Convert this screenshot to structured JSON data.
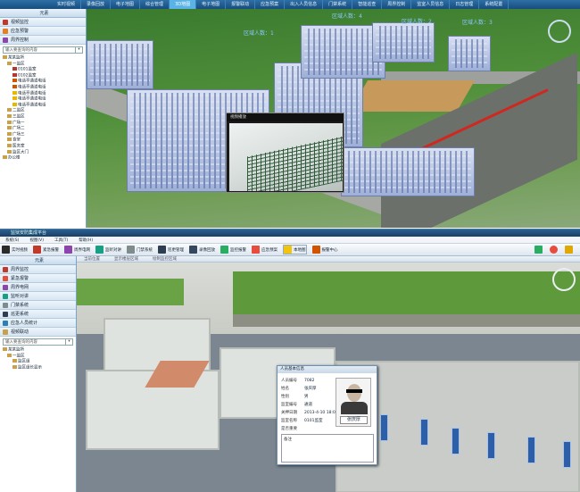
{
  "top": {
    "nav_tabs": [
      "实时视频",
      "录像回放",
      "电子地图",
      "综合管理",
      "3D地图",
      "电子地图",
      "报警联动",
      "应急预案",
      "出入人员信息",
      "门禁系统",
      "智能巡查",
      "周界控制",
      "监室人员信息",
      "日志管理",
      "系统配置"
    ],
    "active_tab": "3D地图",
    "left_header": "元素",
    "side_items": [
      "视频监控",
      "应急预警",
      "周界控制"
    ],
    "search_placeholder": "输入要查询的内容",
    "tree": [
      "某某监所",
      "一监区",
      "0101监室",
      "0102监室",
      "电话亭通道电话",
      "电话亭通道电话",
      "电话亭通道电话",
      "电话亭通道电话",
      "电话亭通道电话",
      "二监区",
      "三监区",
      "广场一",
      "广场二",
      "广场三",
      "食堂",
      "医务室",
      "监区大门",
      "办公楼"
    ],
    "area_labels": [
      "区域人数：4",
      "区域人数：2",
      "区域人数：3",
      "区域人数：1"
    ],
    "video_popup_title": "视频播放"
  },
  "bottom": {
    "title": "监狱安防集成平台",
    "menu": [
      "系统(S)",
      "视图(V)",
      "工具(T)",
      "帮助(H)"
    ],
    "toolbar": [
      "实时视频",
      "紧急报警",
      "周界电网",
      "监听对讲",
      "门禁系统",
      "巡更管理",
      "录像回放",
      "监控报警",
      "应急预案",
      "本地图",
      "报警中心"
    ],
    "toolbar_active": "本地图",
    "subbar": [
      "当前位置",
      "显示楼层区域",
      "绘制监控区域"
    ],
    "left_header": "元素",
    "side_items": [
      "周界监控",
      "紧急报警",
      "周界电网",
      "监听对讲",
      "门禁系统",
      "巡更系统",
      "应急人员统计",
      "视频联动"
    ],
    "search_placeholder": "输入要查询的内容",
    "tree": [
      "某某监所",
      "一监区",
      "监区组",
      "监区组长显示"
    ],
    "card": {
      "title": "人员基本信息",
      "fields": [
        {
          "label": "人员编号",
          "value": "7082"
        },
        {
          "label": "姓名",
          "value": "张庆厚"
        },
        {
          "label": "性别",
          "value": "男"
        },
        {
          "label": "监室编号",
          "value": "通道"
        },
        {
          "label": "关押日期",
          "value": "2013-4-10 18:00:54"
        },
        {
          "label": "监室名称",
          "value": "0101监室"
        },
        {
          "label": "是否重要",
          "value": ""
        }
      ],
      "photo_name": "张庆厚",
      "note_label": "备注"
    }
  }
}
